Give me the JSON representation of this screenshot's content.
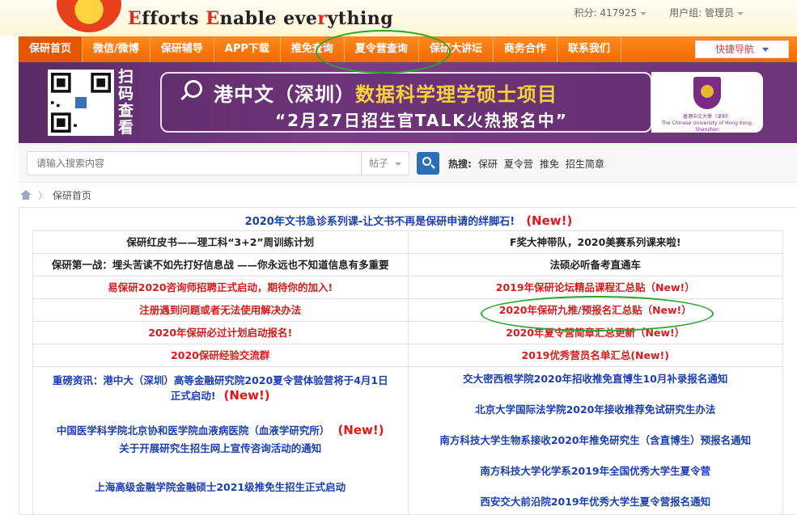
{
  "header": {
    "logo_text_parts": [
      {
        "t": "E",
        "red": true
      },
      {
        "t": "fforts ",
        "red": false
      },
      {
        "t": "E",
        "red": true
      },
      {
        "t": "nable ",
        "red": false
      },
      {
        "t": "eve",
        "red": false
      },
      {
        "t": "r",
        "red": true
      },
      {
        "t": "ything",
        "red": false
      }
    ],
    "points": "积分: 417925",
    "user_group": "用户组: 管理员"
  },
  "nav": {
    "items": [
      "保研首页",
      "微信/微博",
      "保研辅导",
      "APP下载",
      "推免查询",
      "夏令营查询",
      "保研大讲坛",
      "商务合作",
      "联系我们"
    ],
    "quick_nav": "快捷导航"
  },
  "banner": {
    "scan_text": "扫码查看",
    "ad_title_prefix": "港中文（深圳）",
    "ad_title_highlight": "数据科学理学硕士项目",
    "ad_subtitle": "“2月27日招生官TALK火热报名中”",
    "uni_name_cn": "香港中文大學（深圳）",
    "uni_name_en": "The Chinese University of Hong Kong, Shenzhen"
  },
  "search": {
    "placeholder": "请输入搜索内容",
    "type": "帖子",
    "hot_label": "热搜:",
    "hot_terms": [
      "保研",
      "夏令营",
      "推免",
      "招生简章"
    ]
  },
  "breadcrumb": {
    "current": "保研首页"
  },
  "content": {
    "headline": "2020年文书急诊系列课-让文书不再是保研申请的绊脚石!",
    "new_tag": "(New!)",
    "rows": [
      {
        "l": "保研红皮书——理工科“3+2”周训练计划",
        "lc": "blk",
        "r": "F奖大神带队，2020美赛系列课来啦!",
        "rc": "blk"
      },
      {
        "l": "保研第一战：埋头苦读不如先打好信息战 ——你永远也不知道信息有多重要",
        "lc": "blk",
        "r": "法硕必听备考直通车",
        "rc": "blk"
      },
      {
        "l": "易保研2020咨询师招聘正式启动，期待你的加入!",
        "lc": "red",
        "r": "2019年保研论坛精品课程汇总贴（New!）",
        "rc": "red"
      },
      {
        "l": "注册遇到问题或者无法使用解决办法",
        "lc": "red",
        "r": "2020年保研九推/预报名汇总贴（New!）",
        "rc": "red"
      },
      {
        "l": "2020年保研必过计划启动报名!",
        "lc": "red",
        "r": "2020年夏令营简章汇总更新（New!）",
        "rc": "red"
      },
      {
        "l": "2020保研经验交流群",
        "lc": "red",
        "r": "2019优秀营员名单汇总(New!)",
        "rc": "red"
      }
    ],
    "blue_left": {
      "a1": "重磅资讯：港中大（深圳）高等金融研究院2020夏令营体验营将于4月1日",
      "a2": "正式启动!",
      "b": "中国医学科学院北京协和医学院血液病医院（血液学研究所）",
      "c": "关于开展研究生招生网上宣传咨询活动的通知",
      "d": "上海高级金融学院金融硕士2021级推免生招生正式启动"
    },
    "blue_right": [
      "交大密西根学院2020年招收推免直博生10月补录报名通知",
      "北京大学国际法学院2020年接收推荐免试研究生办法",
      "南方科技大学生物系接收2020年推免研究生（含直博生）预报名通知",
      "南方科技大学化学系2019年全国优秀大学生夏令营",
      "西安交大前沿院2019年优秀大学生夏令营报名通知"
    ]
  }
}
